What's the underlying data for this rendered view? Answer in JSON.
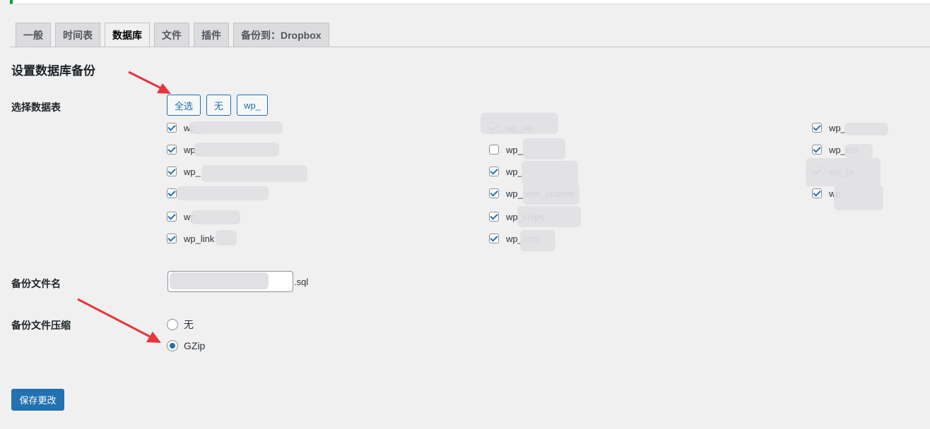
{
  "tabs": [
    {
      "label": "一般",
      "active": false
    },
    {
      "label": "时间表",
      "active": false
    },
    {
      "label": "数据库",
      "active": true
    },
    {
      "label": "文件",
      "active": false
    },
    {
      "label": "插件",
      "active": false
    },
    {
      "label": "备份到：Dropbox",
      "active": false
    }
  ],
  "heading": "设置数据库备份",
  "select_tables": {
    "label": "选择数据表",
    "buttons": {
      "all": "全选",
      "none": "无",
      "prefix": "wp_"
    },
    "columns": [
      [
        {
          "name": "wp_",
          "checked": true
        },
        {
          "name": "wp_",
          "checked": true
        },
        {
          "name": "wp_",
          "checked": true
        },
        {
          "name": "",
          "checked": true
        },
        {
          "name": "wp_",
          "checked": true
        },
        {
          "name": "wp_link",
          "checked": true
        }
      ],
      [
        {
          "name": "wp_op",
          "checked": true
        },
        {
          "name": "wp_",
          "checked": false
        },
        {
          "name": "wp_",
          "checked": true
        },
        {
          "name": "wp_ress_options",
          "checked": true
        },
        {
          "name": "wp_ships",
          "checked": true
        },
        {
          "name": "wp_omy",
          "checked": true
        }
      ],
      [
        {
          "name": "wp_",
          "checked": true
        },
        {
          "name": "wp_ms",
          "checked": true
        },
        {
          "name": "wp_ta",
          "checked": true
        },
        {
          "name": "wp",
          "checked": true
        }
      ]
    ]
  },
  "filename": {
    "label": "备份文件名",
    "value": "",
    "suffix": ".sql"
  },
  "compression": {
    "label": "备份文件压缩",
    "options": [
      {
        "label": "无",
        "checked": false
      },
      {
        "label": "GZip",
        "checked": true
      }
    ]
  },
  "save_label": "保存更改",
  "colors": {
    "accent": "#2271b1",
    "annotation_arrow": "#e8343a",
    "background": "#f0f0f1"
  }
}
